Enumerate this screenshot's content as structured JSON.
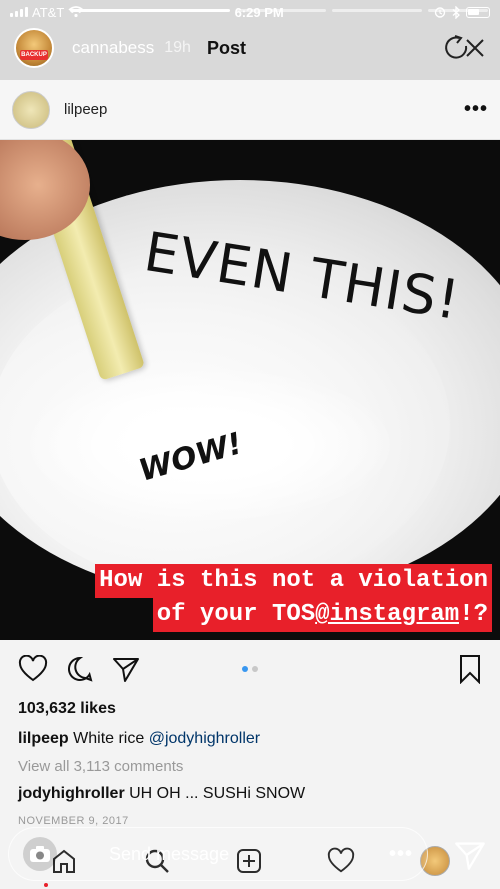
{
  "status_bar": {
    "carrier": "AT&T",
    "time": "6:29 PM"
  },
  "story": {
    "username": "cannabess",
    "time_ago": "19h",
    "label": "Post",
    "avatar_text": "BACKUP"
  },
  "post": {
    "username": "lilpeep",
    "more_label": "•••",
    "overlay_text": "EVEN THIS!",
    "wow_text": "WOW!",
    "banner_line1": "How is this not a violation",
    "banner_line2_pre": "of your TOS ",
    "banner_handle": "@instagram",
    "banner_line2_post": "!?",
    "likes": "103,632 likes",
    "caption_user": "lilpeep",
    "caption_text": " White rice ",
    "caption_mention": "@jodyhighroller",
    "view_comments": "View all 3,113 comments",
    "comment_user": "jodyhighroller",
    "comment_text": " UH OH ... SUSHi SNOW",
    "date": "NOVEMBER 9, 2017",
    "carousel_active_index": 1,
    "carousel_count": 2
  },
  "reply_bar": {
    "placeholder": "Send message",
    "more_label": "•••"
  },
  "colors": {
    "banner_red": "#e8202a",
    "active_dot": "#3897f0",
    "mention": "#003569"
  },
  "icons": [
    "signal-icon",
    "wifi-icon",
    "alarm-icon",
    "bluetooth-icon",
    "battery-icon",
    "refresh-icon",
    "close-icon",
    "more-icon",
    "heart-icon",
    "comment-icon",
    "share-icon",
    "bookmark-icon",
    "home-icon",
    "search-icon",
    "add-icon",
    "camera-icon",
    "send-icon"
  ]
}
